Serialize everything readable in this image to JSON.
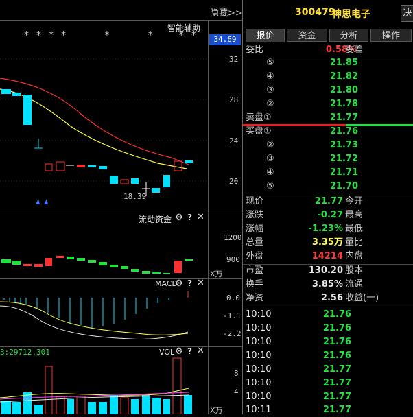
{
  "header": {
    "hide_label": "隐藏>>",
    "stock_code": "300479",
    "stock_name": "神思电子",
    "right_button": "决"
  },
  "main_chart": {
    "indicator_label": "智能辅助",
    "stars": "* * * *      *      *    * *",
    "current_price_tag": "34.69",
    "y_ticks": [
      "32",
      "28",
      "24",
      "20"
    ],
    "low_label": "18.39"
  },
  "tabs": [
    "报价",
    "资金",
    "分析",
    "操作"
  ],
  "order_book": {
    "weibi_label": "委比",
    "weibi_value": "0.58%",
    "weicha_label": "委差",
    "sell": [
      {
        "level": "⑤",
        "price": "21.85"
      },
      {
        "level": "④",
        "price": "21.82"
      },
      {
        "level": "③",
        "price": "21.80"
      },
      {
        "level": "②",
        "price": "21.78"
      },
      {
        "level": "卖盘①",
        "price": "21.77"
      }
    ],
    "buy": [
      {
        "level": "买盘①",
        "price": "21.76"
      },
      {
        "level": "②",
        "price": "21.73"
      },
      {
        "level": "③",
        "price": "21.72"
      },
      {
        "level": "④",
        "price": "21.71"
      },
      {
        "level": "⑤",
        "price": "21.70"
      }
    ]
  },
  "quote": [
    {
      "label": "现价",
      "value": "21.77",
      "label2": "今开"
    },
    {
      "label": "涨跌",
      "value": "-0.27",
      "label2": "最高"
    },
    {
      "label": "涨幅",
      "value": "-1.23%",
      "label2": "最低"
    },
    {
      "label": "总量",
      "value": "3.35万",
      "label2": "量比"
    },
    {
      "label": "外盘",
      "value": "14214",
      "label2": "内盘"
    }
  ],
  "fundamentals": [
    {
      "label": "市盈",
      "value": "130.20",
      "label2": "股本"
    },
    {
      "label": "换手",
      "value": "3.85%",
      "label2": "流通"
    },
    {
      "label": "净资",
      "value": "2.56",
      "label2": "收益(一)"
    }
  ],
  "ticks": [
    {
      "time": "10:10",
      "price": "21.76"
    },
    {
      "time": "10:10",
      "price": "21.76"
    },
    {
      "time": "10:10",
      "price": "21.76"
    },
    {
      "time": "10:10",
      "price": "21.76"
    },
    {
      "time": "10:10",
      "price": "21.77"
    },
    {
      "time": "10:10",
      "price": "21.77"
    },
    {
      "time": "10:10",
      "price": "21.77"
    },
    {
      "time": "10:11",
      "price": "21.77"
    }
  ],
  "panels": {
    "flow_label": "流动资金",
    "flow_ticks": [
      "1200",
      "900"
    ],
    "flow_unit": "X万",
    "macd_label": "MACD",
    "macd_ticks": [
      "0.0",
      "-1.1",
      "-2.2"
    ],
    "vol_label": "VOL",
    "vol_header": "3:29712.301",
    "vol_ticks": [
      "8",
      "4"
    ],
    "vol_unit": "X万"
  },
  "icons": {
    "settings": "gear-icon",
    "help": "question-icon",
    "close": "close-icon"
  },
  "colors": {
    "up": "#ff3a3a",
    "down": "#00e0ff",
    "ma1": "#ff3030",
    "ma2": "#ffff40",
    "price_green": "#22e040"
  }
}
